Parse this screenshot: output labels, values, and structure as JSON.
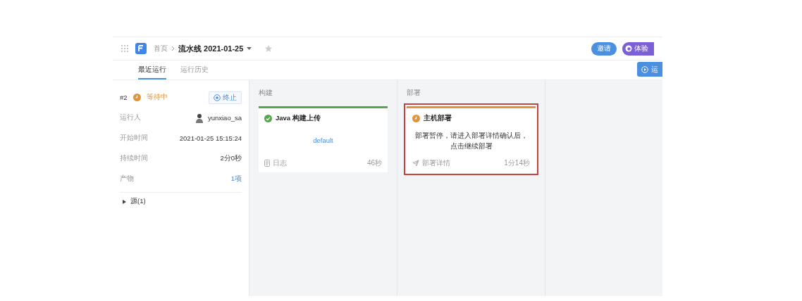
{
  "header": {
    "breadcrumb": [
      {
        "label": "首页",
        "current": false
      },
      {
        "label": "流水线 2021-01-25",
        "current": true
      }
    ],
    "starred": false,
    "invite_button": "邀请",
    "trial_button": "体验",
    "run_button": "运"
  },
  "tabs": [
    {
      "label": "最近运行",
      "selected": true
    },
    {
      "label": "运行历史",
      "selected": false
    }
  ],
  "run": {
    "number": "#2",
    "color": "#e3923a",
    "status_label": "等待中",
    "stop_button": "终止",
    "details": [
      {
        "label": "运行人",
        "value": "yunxiao_sa",
        "kind": "user"
      },
      {
        "label": "开始时间",
        "value": "2021-01-25 15:15:24",
        "kind": "text"
      },
      {
        "label": "持续时间",
        "value": "2分0秒",
        "kind": "text"
      },
      {
        "label": "产物",
        "value": "1项",
        "kind": "link"
      }
    ],
    "sources": {
      "label": "源(1)",
      "expanded": false
    }
  },
  "stages": [
    {
      "title": "构建",
      "jobs": [
        {
          "name": "Java 构建上传",
          "color": "#52a84a",
          "kind": "log",
          "highlighted": false,
          "body": {
            "kind": "link",
            "text": "default"
          },
          "footer_link": "日志",
          "duration": "46秒"
        }
      ]
    },
    {
      "title": "部署",
      "jobs": [
        {
          "name": "主机部署",
          "color": "#e3923a",
          "kind": "send",
          "highlighted": true,
          "body": {
            "kind": "message",
            "text": "部署暂停，请进入部署详情确认后，点击继续部署"
          },
          "footer_link": "部署详情",
          "duration": "1分14秒"
        }
      ]
    }
  ]
}
